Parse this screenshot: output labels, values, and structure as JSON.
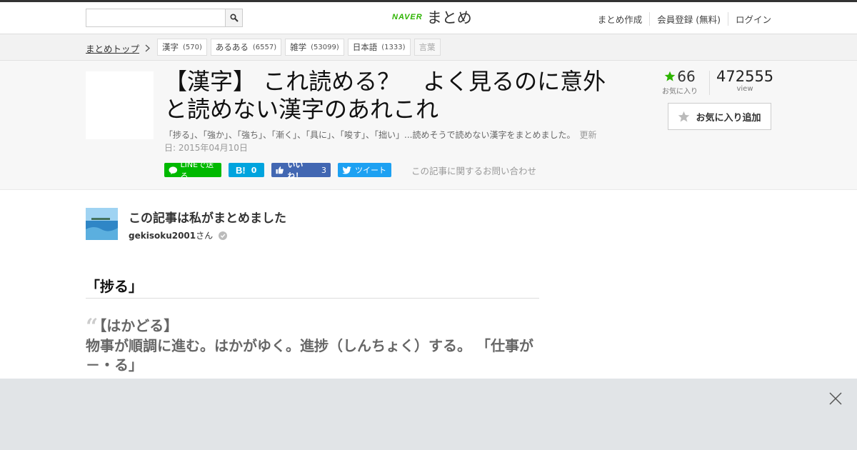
{
  "header": {
    "search": {
      "placeholder": "",
      "value": ""
    },
    "logo": {
      "brand": "NAVER",
      "name": "まとめ"
    },
    "links": [
      "まとめ作成",
      "会員登録 (無料)",
      "ログイン"
    ]
  },
  "breadcrumb": {
    "top": "まとめトップ",
    "tags": [
      {
        "label": "漢字",
        "count": "(570)"
      },
      {
        "label": "あるある",
        "count": "(6557)"
      },
      {
        "label": "雑学",
        "count": "(53099)"
      },
      {
        "label": "日本語",
        "count": "(1333)"
      },
      {
        "label": "言葉",
        "count": ""
      }
    ]
  },
  "article": {
    "title": "【漢字】 これ読める？　よく見るのに意外と読めない漢字のあれこれ",
    "description": "「捗る」、「強か」、「強ち」、「漸く」、「具に」、「唆す」、「拙い」...読めそうで読めない漢字をまとめました。",
    "updated": "更新日: 2015年04月10日",
    "favorites": {
      "count": "66",
      "label": "お気に入り"
    },
    "views": {
      "count": "472555",
      "label": "view"
    },
    "fav_button": "お気に入り追加"
  },
  "social": {
    "line": "LINEで送る",
    "hatena": "0",
    "like": "いいね！",
    "like_count": "3",
    "tweet": "ツイート",
    "contact": "この記事に関するお問い合わせ"
  },
  "author": {
    "title": "この記事は私がまとめました",
    "name": "gekisoku2001",
    "suffix": "さん"
  },
  "content": {
    "heading": "「捗る」",
    "quote_title": "【はかどる】",
    "quote_body": "物事が順調に進む。はかがゆく。進捗（しんちょく）する。 「仕事が－・る」"
  },
  "colors": {
    "accent_green": "#2db400",
    "line": "#00b900",
    "hatena": "#00a4de",
    "facebook": "#4267b2",
    "twitter": "#1da1f2"
  }
}
